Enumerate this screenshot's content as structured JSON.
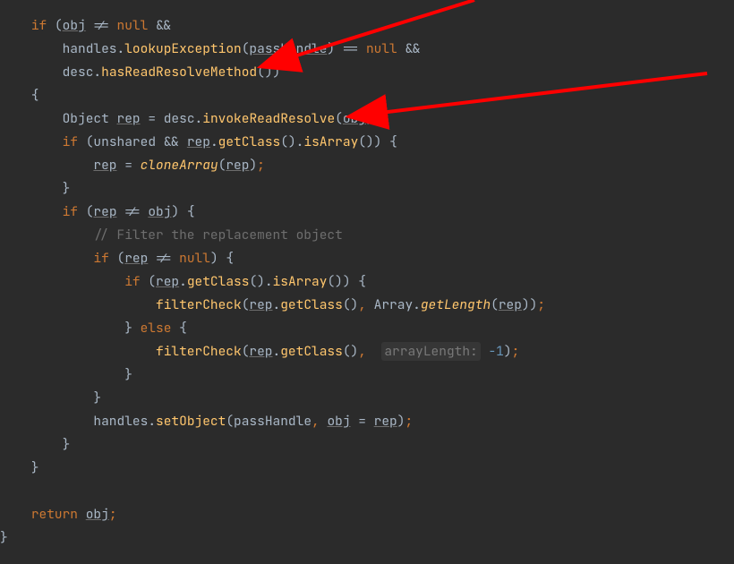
{
  "code": {
    "kw_if": "if",
    "kw_else": "else",
    "kw_return": "return",
    "kw_null": "null",
    "var_obj": "obj",
    "var_handles": "handles",
    "var_desc": "desc",
    "var_rep": "rep",
    "var_unshared": "unshared",
    "type_object": "Object",
    "type_array": "Array",
    "var_passHandle": "passHandle",
    "m_lookupException": "lookupException",
    "m_hasReadResolveMethod": "hasReadResolveMethod",
    "m_invokeReadResolve": "invokeReadResolve",
    "m_getClass": "getClass",
    "m_isArray": "isArray",
    "m_cloneArray": "cloneArray",
    "m_filterCheck": "filterCheck",
    "m_getLength": "getLength",
    "m_setObject": "setObject",
    "comment_filter": "// Filter the replacement object",
    "hint_arrayLength": "arrayLength:",
    "lit_neg1": "-1",
    "op_ne": "!=",
    "op_eq": "==",
    "op_and": "&&",
    "op_assign": "="
  },
  "arrows": [
    {
      "name": "arrow-1",
      "color": "#ff0000"
    },
    {
      "name": "arrow-2",
      "color": "#ff0000"
    }
  ]
}
